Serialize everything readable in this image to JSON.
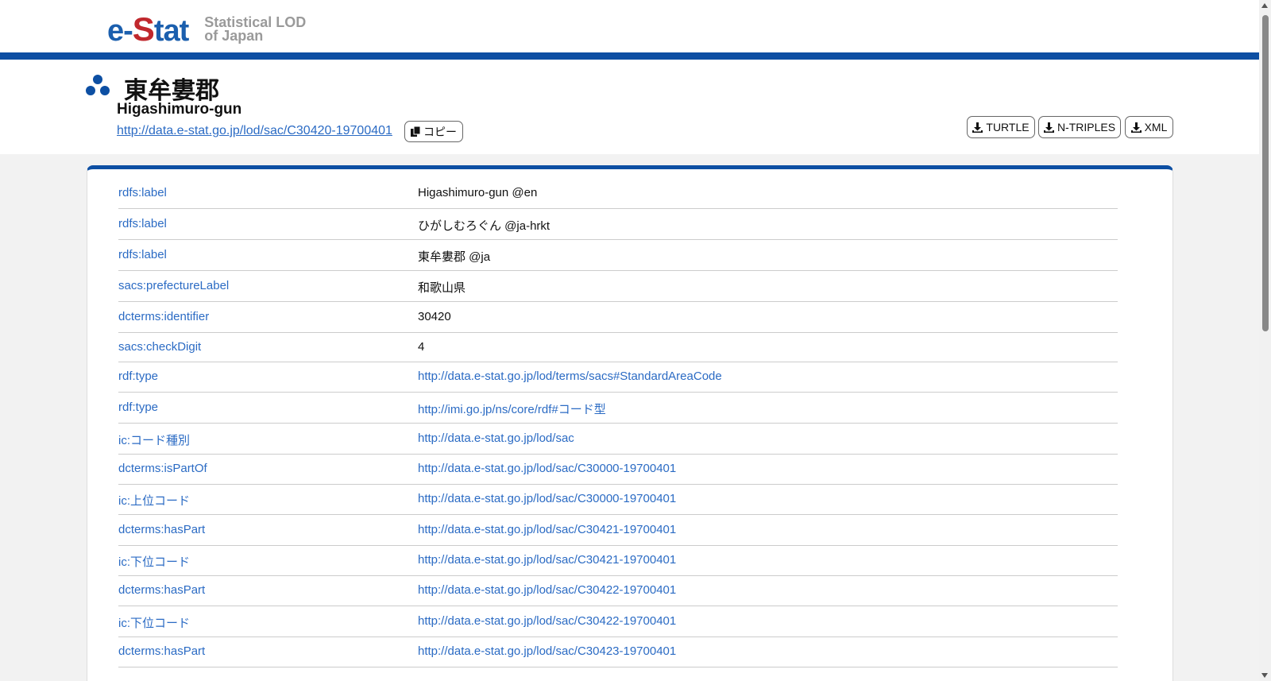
{
  "header": {
    "logo_e": "e-",
    "logo_s": "S",
    "logo_tat": "tat",
    "logo_sub_line1": "Statistical LOD",
    "logo_sub_line2": "of Japan",
    "brand_blue": "#1b5fae",
    "brand_red": "#c0282d"
  },
  "resource": {
    "title_ja": "東牟婁郡",
    "title_en": "Higashimuro-gun",
    "uri": "http://data.e-stat.go.jp/lod/sac/C30420-19700401",
    "copy_label": "コピー",
    "icon": "resource-cluster-icon"
  },
  "downloads": {
    "turtle": "TURTLE",
    "ntriples": "N-TRIPLES",
    "xml": "XML",
    "icon": "download-icon"
  },
  "triples": [
    {
      "predicate": "rdfs:label",
      "object": "Higashimuro-gun @en",
      "link": false
    },
    {
      "predicate": "rdfs:label",
      "object": "ひがしむろぐん @ja-hrkt",
      "link": false
    },
    {
      "predicate": "rdfs:label",
      "object": "東牟婁郡 @ja",
      "link": false
    },
    {
      "predicate": "sacs:prefectureLabel",
      "object": "和歌山県",
      "link": false
    },
    {
      "predicate": "dcterms:identifier",
      "object": "30420",
      "link": false
    },
    {
      "predicate": "sacs:checkDigit",
      "object": "4",
      "link": false
    },
    {
      "predicate": "rdf:type",
      "object": "http://data.e-stat.go.jp/lod/terms/sacs#StandardAreaCode",
      "link": true
    },
    {
      "predicate": "rdf:type",
      "object": "http://imi.go.jp/ns/core/rdf#コード型",
      "link": true
    },
    {
      "predicate": "ic:コード種別",
      "object": "http://data.e-stat.go.jp/lod/sac",
      "link": true
    },
    {
      "predicate": "dcterms:isPartOf",
      "object": "http://data.e-stat.go.jp/lod/sac/C30000-19700401",
      "link": true
    },
    {
      "predicate": "ic:上位コード",
      "object": "http://data.e-stat.go.jp/lod/sac/C30000-19700401",
      "link": true
    },
    {
      "predicate": "dcterms:hasPart",
      "object": "http://data.e-stat.go.jp/lod/sac/C30421-19700401",
      "link": true
    },
    {
      "predicate": "ic:下位コード",
      "object": "http://data.e-stat.go.jp/lod/sac/C30421-19700401",
      "link": true
    },
    {
      "predicate": "dcterms:hasPart",
      "object": "http://data.e-stat.go.jp/lod/sac/C30422-19700401",
      "link": true
    },
    {
      "predicate": "ic:下位コード",
      "object": "http://data.e-stat.go.jp/lod/sac/C30422-19700401",
      "link": true
    },
    {
      "predicate": "dcterms:hasPart",
      "object": "http://data.e-stat.go.jp/lod/sac/C30423-19700401",
      "link": true
    }
  ],
  "colors": {
    "accent": "#0d4fa3",
    "link": "#2b6bc4"
  }
}
